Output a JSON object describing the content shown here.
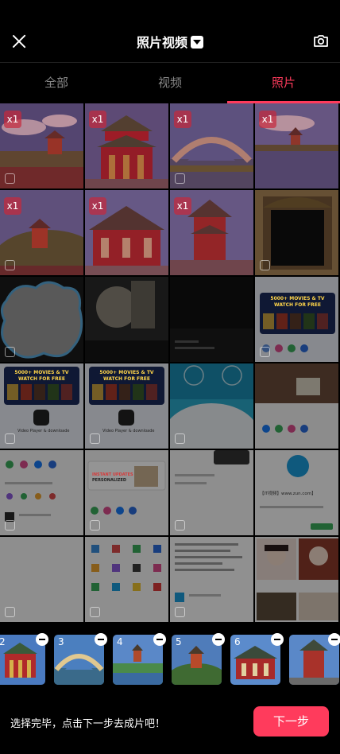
{
  "header": {
    "title": "照片视频",
    "close_icon": "close-icon",
    "dropdown_icon": "chevron-down-icon",
    "camera_icon": "camera-icon"
  },
  "tabs": [
    {
      "label": "全部",
      "active": false
    },
    {
      "label": "视频",
      "active": false
    },
    {
      "label": "照片",
      "active": true
    }
  ],
  "grid": {
    "badges": [
      "x1",
      "x1",
      "x1",
      "x1",
      "x1",
      "x1",
      "x1"
    ],
    "thumb_texts": {
      "movies_banner_line1": "5000+ MOVIES & TV",
      "movies_banner_line2": "WATCH FOR FREE",
      "video_player": "Video Player & downloade",
      "instant_updates": "INSTANT UPDATES",
      "personalized": "PERSONALIZED",
      "site_text": "【IT视频】www.zun.com】"
    }
  },
  "tray": {
    "thumbs": [
      {
        "num": "2"
      },
      {
        "num": "3"
      },
      {
        "num": "4"
      },
      {
        "num": "5"
      },
      {
        "num": "6"
      },
      {
        "num": ""
      }
    ],
    "hint": "选择完毕，点击下一步去成片吧！",
    "next_label": "下一步"
  },
  "colors": {
    "accent": "#ff3b5c",
    "background": "#000000"
  }
}
